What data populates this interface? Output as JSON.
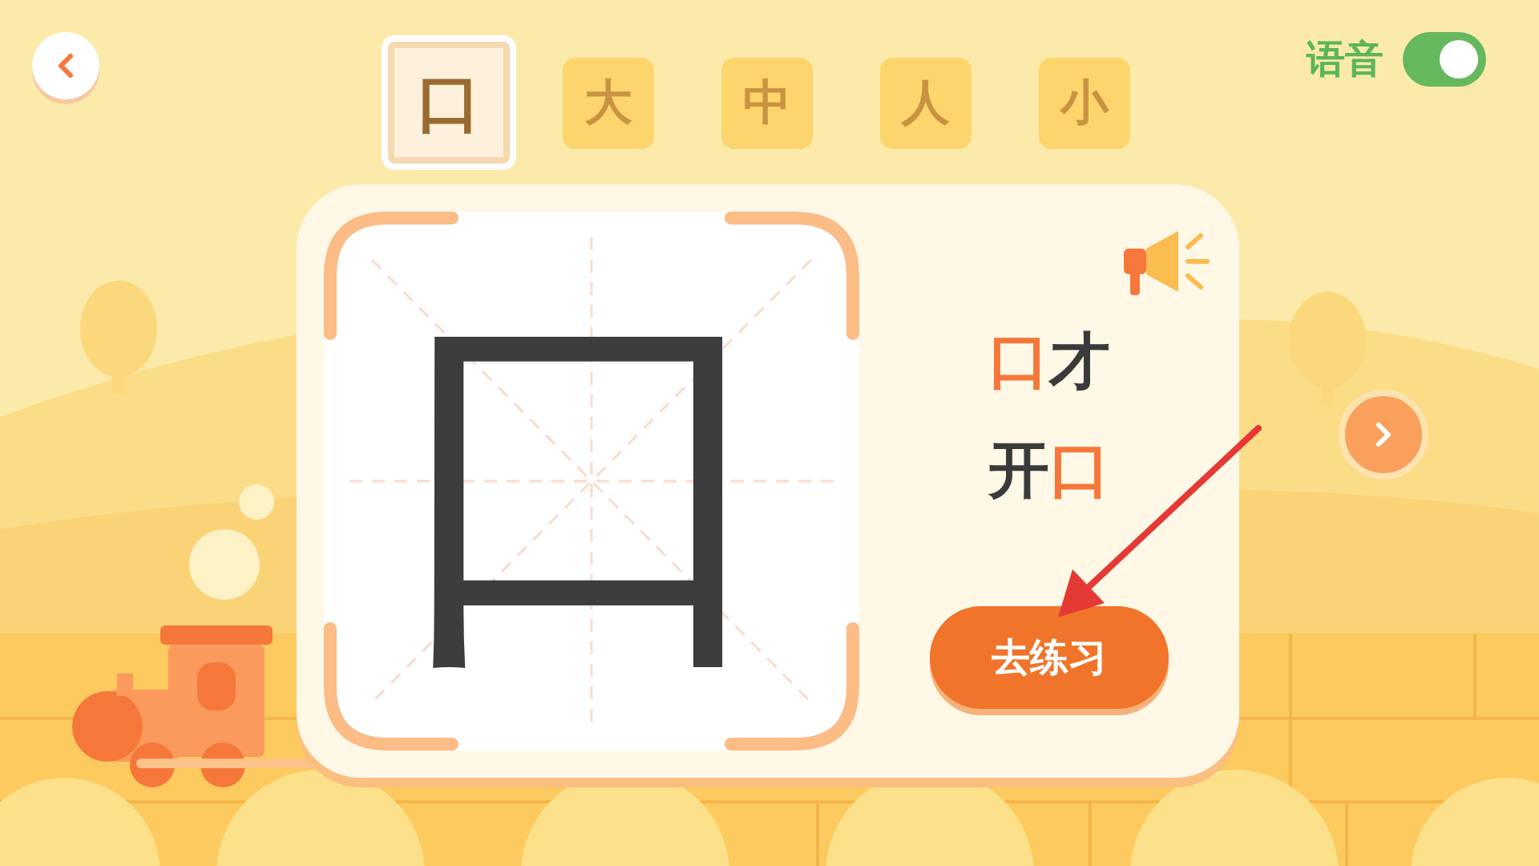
{
  "tabs": [
    {
      "label": "口",
      "selected": true
    },
    {
      "label": "大",
      "selected": false
    },
    {
      "label": "中",
      "selected": false
    },
    {
      "label": "人",
      "selected": false
    },
    {
      "label": "小",
      "selected": false
    }
  ],
  "voice": {
    "label": "语音",
    "on": true
  },
  "character": {
    "glyph": "口"
  },
  "words": [
    {
      "parts": [
        {
          "text": "口",
          "highlight": true
        },
        {
          "text": "才",
          "highlight": false
        }
      ]
    },
    {
      "parts": [
        {
          "text": "开",
          "highlight": false
        },
        {
          "text": "口",
          "highlight": true
        }
      ]
    }
  ],
  "practice_button": {
    "label": "去练习"
  }
}
